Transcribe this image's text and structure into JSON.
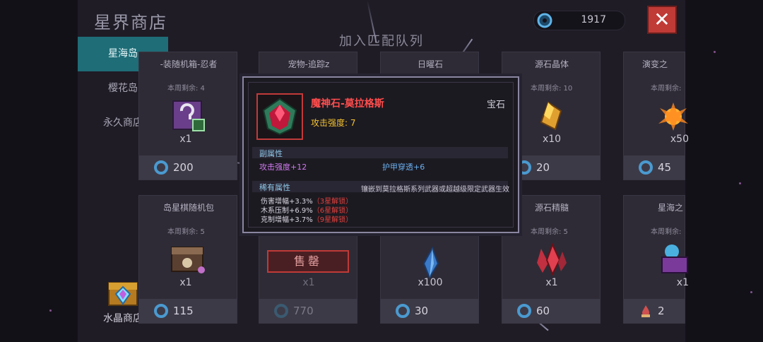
{
  "header": {
    "title": "星界商店",
    "currency_value": "1917",
    "close_label": "✕",
    "queue_text": "加入匹配队列"
  },
  "sidebar": {
    "items": [
      {
        "label": "星海岛",
        "active": true
      },
      {
        "label": "樱花岛",
        "active": false
      },
      {
        "label": "永久商店",
        "active": false
      }
    ],
    "crystal_shop_label": "水晶商店"
  },
  "cards": [
    {
      "name": "-装随机箱-忍者",
      "stock": "本周剩余: 4",
      "qty": "x1",
      "price": "200"
    },
    {
      "name": "宠物-追踪z",
      "stock": "",
      "qty": "",
      "price": ""
    },
    {
      "name": "日曜石",
      "stock": "",
      "qty": "",
      "price": ""
    },
    {
      "name": "源石晶体",
      "stock": "本周剩余: 10",
      "qty": "x10",
      "price": "20"
    },
    {
      "name": "演变之",
      "stock": "本周剩余:",
      "qty": "x50",
      "price": "45"
    },
    {
      "name": "岛星棋随机包",
      "stock": "本周剩余: 5",
      "qty": "x1",
      "price": "115"
    },
    {
      "name": "",
      "stock": "",
      "qty": "x1",
      "price": "770"
    },
    {
      "name": "",
      "stock": "",
      "qty": "x100",
      "price": "30"
    },
    {
      "name": "源石精髓",
      "stock": "本周剩余: 5",
      "qty": "x1",
      "price": "60"
    },
    {
      "name": "星海之",
      "stock": "本周剩余:",
      "qty": "x1",
      "price": "2"
    }
  ],
  "sold_out_label": "售罄",
  "tooltip": {
    "name": "魔神石-莫拉格斯",
    "type": "宝石",
    "attack": "攻击强度: 7",
    "sub_title": "副属性",
    "sub_attr_1": "攻击强度+12",
    "sub_attr_2": "护甲穿透+6",
    "rare_title": "稀有属性",
    "rare_note": "镶嵌到莫拉格斯系列武器或超越级限定武器生效",
    "rare_attrs": [
      {
        "text": "伤害增幅+3.3%",
        "lock": "（3星解锁）"
      },
      {
        "text": "木系压制+6.9%",
        "lock": "（6星解锁）"
      },
      {
        "text": "克制增幅+3.7%",
        "lock": "（9星解锁）"
      }
    ]
  },
  "icons": {
    "currency": "star-coin-icon",
    "close": "close-icon",
    "gem": "ruby-gem-icon"
  },
  "colors": {
    "accent_teal": "#1e6d77",
    "close_red": "#c03a36",
    "gem_name": "#ff4d4d",
    "attack_gold": "#f2c230"
  }
}
